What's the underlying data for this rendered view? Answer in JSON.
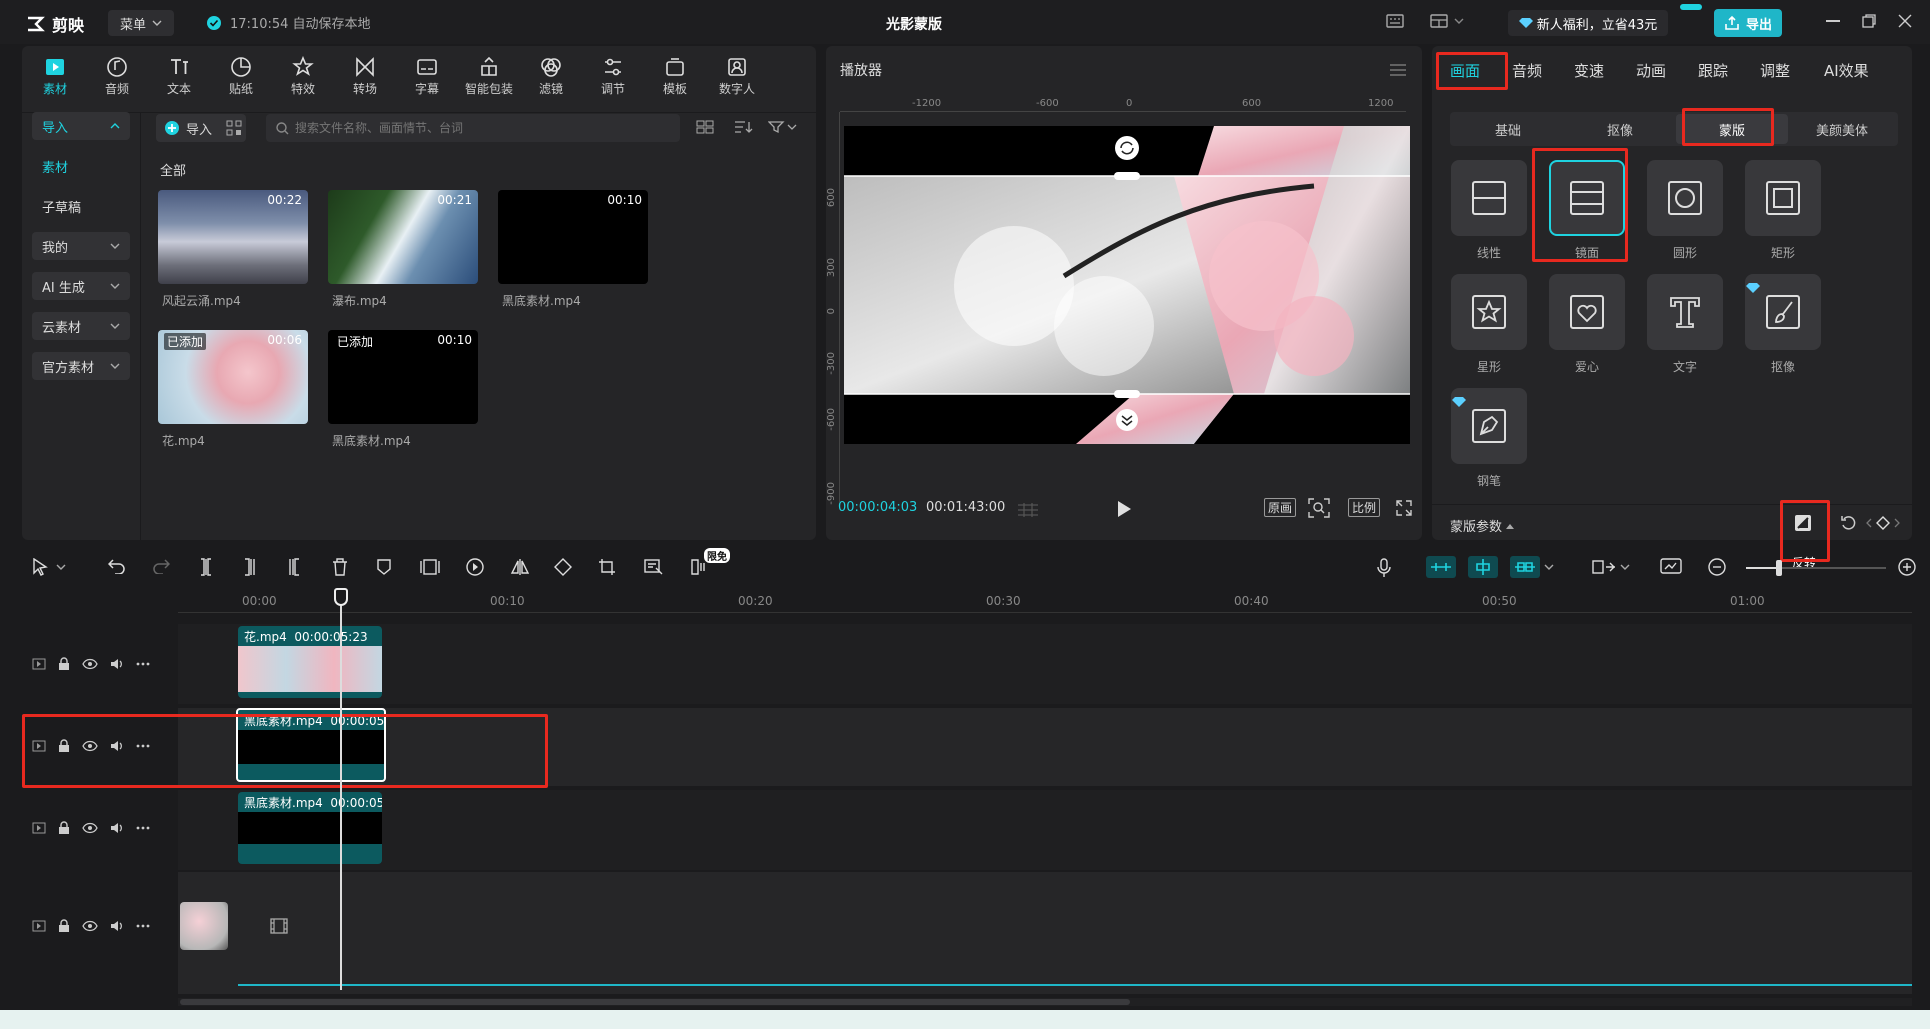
{
  "app": {
    "logo": "剪映",
    "menu": "菜单",
    "save_status": "17:10:54 自动保存本地",
    "project_title": "光影蒙版",
    "promo": "新人福利，立省43元",
    "export": "导出"
  },
  "toolbar": [
    {
      "label": "素材",
      "icon": "media-icon"
    },
    {
      "label": "音频",
      "icon": "audio-icon"
    },
    {
      "label": "文本",
      "icon": "text-icon"
    },
    {
      "label": "贴纸",
      "icon": "sticker-icon"
    },
    {
      "label": "特效",
      "icon": "effects-icon"
    },
    {
      "label": "转场",
      "icon": "transition-icon"
    },
    {
      "label": "字幕",
      "icon": "subtitle-icon"
    },
    {
      "label": "智能包装",
      "icon": "smart-pack-icon"
    },
    {
      "label": "滤镜",
      "icon": "filter-icon"
    },
    {
      "label": "调节",
      "icon": "adjust-icon"
    },
    {
      "label": "模板",
      "icon": "template-icon"
    },
    {
      "label": "数字人",
      "icon": "avatar-icon"
    }
  ],
  "sidebar": {
    "items": [
      {
        "label": "导入"
      },
      {
        "label": "素材"
      },
      {
        "label": "子草稿"
      },
      {
        "label": "我的"
      },
      {
        "label": "AI 生成"
      },
      {
        "label": "云素材"
      },
      {
        "label": "官方素材"
      }
    ]
  },
  "media": {
    "import_label": "导入",
    "search_placeholder": "搜索文件名称、画面情节、台词",
    "all_label": "全部",
    "added_label": "已添加",
    "items": [
      {
        "name": "风起云涌.mp4",
        "duration": "00:22"
      },
      {
        "name": "瀑布.mp4",
        "duration": "00:21"
      },
      {
        "name": "黑底素材.mp4",
        "duration": "00:10"
      },
      {
        "name": "花.mp4",
        "duration": "00:06"
      },
      {
        "name": "黑底素材.mp4",
        "duration": "00:10"
      }
    ]
  },
  "player": {
    "title": "播放器",
    "current_time": "00:00:04:03",
    "total_time": "00:01:43:00",
    "btn_original": "原画",
    "btn_ratio": "比例",
    "ruler_top": [
      "-1200",
      "-600",
      "0",
      "600",
      "1200"
    ],
    "ruler_left": [
      "600",
      "300",
      "0",
      "-300",
      "-600",
      "-900"
    ]
  },
  "properties": {
    "tabs": [
      "画面",
      "音频",
      "变速",
      "动画",
      "跟踪",
      "调整",
      "AI效果"
    ],
    "subtabs": [
      "基础",
      "抠像",
      "蒙版",
      "美颜美体"
    ],
    "masks": [
      "线性",
      "镜面",
      "圆形",
      "矩形",
      "星形",
      "爱心",
      "文字",
      "抠像",
      "钢笔"
    ],
    "mask_params": "蒙版参数",
    "invert_tooltip": "反转"
  },
  "timeline": {
    "badge": "限免",
    "ruler": [
      "00:00",
      "00:10",
      "00:20",
      "00:30",
      "00:40",
      "00:50",
      "01:00"
    ],
    "clips": [
      {
        "name": "花.mp4",
        "duration": "00:00:05:23"
      },
      {
        "name": "黑底素材.mp4",
        "duration": "00:00:05"
      },
      {
        "name": "黑底素材.mp4",
        "duration": "00:00:05"
      }
    ]
  },
  "colors": {
    "accent": "#1fd3e0",
    "highlight_box": "#e8291f",
    "clip": "#0c5a5f"
  }
}
